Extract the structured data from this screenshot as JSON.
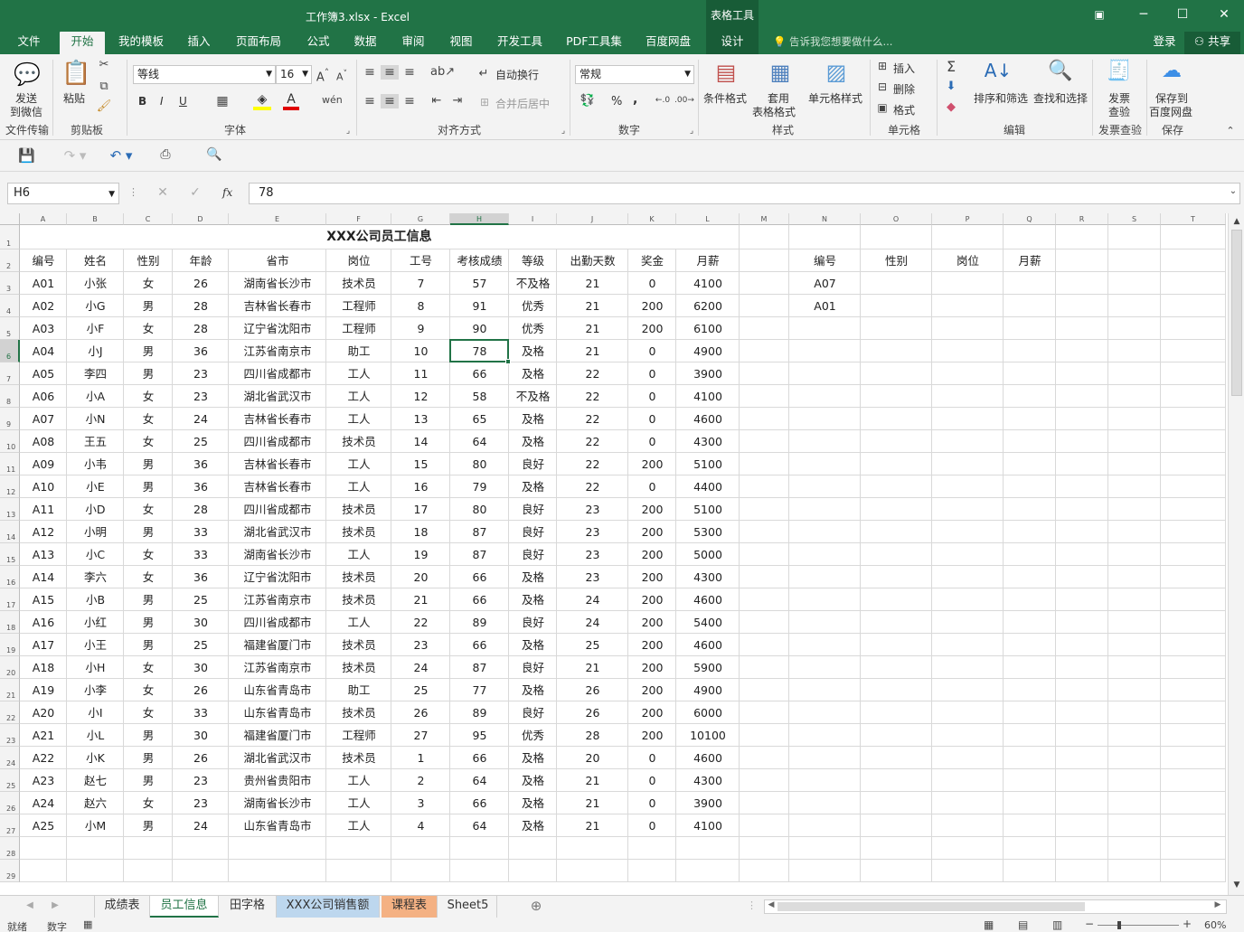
{
  "window": {
    "title": "工作簿3.xlsx - Excel",
    "context_group": "表格工具",
    "restore_icon": "ribbon-display-icon",
    "min": "─",
    "max": "☐",
    "close": "✕"
  },
  "tabs": [
    {
      "label": "文件"
    },
    {
      "label": "开始"
    },
    {
      "label": "我的模板"
    },
    {
      "label": "插入"
    },
    {
      "label": "页面布局"
    },
    {
      "label": "公式"
    },
    {
      "label": "数据"
    },
    {
      "label": "审阅"
    },
    {
      "label": "视图"
    },
    {
      "label": "开发工具"
    },
    {
      "label": "PDF工具集"
    },
    {
      "label": "百度网盘"
    },
    {
      "label": "设计"
    }
  ],
  "tell_me": "告诉我您想要做什么...",
  "login": "登录",
  "share": "共享",
  "ribbon": {
    "send_wechat": [
      "发送",
      "到微信"
    ],
    "paste": "粘贴",
    "font_name": "等线",
    "font_size": "16",
    "bold": "B",
    "italic": "I",
    "underline": "U",
    "wrap_text": "自动换行",
    "merge_center": "合并后居中",
    "number_format": "常规",
    "percent": "%",
    "comma": ",",
    "cond_format": "条件格式",
    "table_format": [
      "套用",
      "表格格式"
    ],
    "cell_style": "单元格样式",
    "insert": "插入",
    "delete": "删除",
    "format": "格式",
    "sort_filter": "排序和筛选",
    "find_select": "查找和选择",
    "invoice": [
      "发票",
      "查验"
    ],
    "save_baidu": [
      "保存到",
      "百度网盘"
    ],
    "groups": [
      "文件传输",
      "剪贴板",
      "字体",
      "对齐方式",
      "数字",
      "样式",
      "单元格",
      "编辑",
      "发票查验",
      "保存"
    ]
  },
  "formula_bar": {
    "name_box": "H6",
    "value": "78",
    "fx": "fx"
  },
  "columns": [
    "A",
    "B",
    "C",
    "D",
    "E",
    "F",
    "G",
    "H",
    "I",
    "J",
    "K",
    "L",
    "M",
    "N",
    "O",
    "P",
    "Q",
    "R",
    "S",
    "T"
  ],
  "rows": [
    "1",
    "2",
    "3",
    "4",
    "5",
    "6",
    "7",
    "8",
    "9",
    "10",
    "11",
    "12",
    "13",
    "14",
    "15",
    "16",
    "17",
    "18",
    "19",
    "20",
    "21",
    "22",
    "23",
    "24",
    "25",
    "26",
    "27",
    "28",
    "29"
  ],
  "sheet_title": "XXX公司员工信息",
  "table": {
    "headers": [
      "编号",
      "姓名",
      "性别",
      "年龄",
      "省市",
      "岗位",
      "工号",
      "考核成绩",
      "等级",
      "出勤天数",
      "奖金",
      "月薪"
    ],
    "rows": [
      [
        "A01",
        "小张",
        "女",
        "26",
        "湖南省长沙市",
        "技术员",
        "7",
        "57",
        "不及格",
        "21",
        "0",
        "4100"
      ],
      [
        "A02",
        "小G",
        "男",
        "28",
        "吉林省长春市",
        "工程师",
        "8",
        "91",
        "优秀",
        "21",
        "200",
        "6200"
      ],
      [
        "A03",
        "小F",
        "女",
        "28",
        "辽宁省沈阳市",
        "工程师",
        "9",
        "90",
        "优秀",
        "21",
        "200",
        "6100"
      ],
      [
        "A04",
        "小J",
        "男",
        "36",
        "江苏省南京市",
        "助工",
        "10",
        "78",
        "及格",
        "21",
        "0",
        "4900"
      ],
      [
        "A05",
        "李四",
        "男",
        "23",
        "四川省成都市",
        "工人",
        "11",
        "66",
        "及格",
        "22",
        "0",
        "3900"
      ],
      [
        "A06",
        "小A",
        "女",
        "23",
        "湖北省武汉市",
        "工人",
        "12",
        "58",
        "不及格",
        "22",
        "0",
        "4100"
      ],
      [
        "A07",
        "小N",
        "女",
        "24",
        "吉林省长春市",
        "工人",
        "13",
        "65",
        "及格",
        "22",
        "0",
        "4600"
      ],
      [
        "A08",
        "王五",
        "女",
        "25",
        "四川省成都市",
        "技术员",
        "14",
        "64",
        "及格",
        "22",
        "0",
        "4300"
      ],
      [
        "A09",
        "小韦",
        "男",
        "36",
        "吉林省长春市",
        "工人",
        "15",
        "80",
        "良好",
        "22",
        "200",
        "5100"
      ],
      [
        "A10",
        "小E",
        "男",
        "36",
        "吉林省长春市",
        "工人",
        "16",
        "79",
        "及格",
        "22",
        "0",
        "4400"
      ],
      [
        "A11",
        "小D",
        "女",
        "28",
        "四川省成都市",
        "技术员",
        "17",
        "80",
        "良好",
        "23",
        "200",
        "5100"
      ],
      [
        "A12",
        "小明",
        "男",
        "33",
        "湖北省武汉市",
        "技术员",
        "18",
        "87",
        "良好",
        "23",
        "200",
        "5300"
      ],
      [
        "A13",
        "小C",
        "女",
        "33",
        "湖南省长沙市",
        "工人",
        "19",
        "87",
        "良好",
        "23",
        "200",
        "5000"
      ],
      [
        "A14",
        "李六",
        "女",
        "36",
        "辽宁省沈阳市",
        "技术员",
        "20",
        "66",
        "及格",
        "23",
        "200",
        "4300"
      ],
      [
        "A15",
        "小B",
        "男",
        "25",
        "江苏省南京市",
        "技术员",
        "21",
        "66",
        "及格",
        "24",
        "200",
        "4600"
      ],
      [
        "A16",
        "小红",
        "男",
        "30",
        "四川省成都市",
        "工人",
        "22",
        "89",
        "良好",
        "24",
        "200",
        "5400"
      ],
      [
        "A17",
        "小王",
        "男",
        "25",
        "福建省厦门市",
        "技术员",
        "23",
        "66",
        "及格",
        "25",
        "200",
        "4600"
      ],
      [
        "A18",
        "小H",
        "女",
        "30",
        "江苏省南京市",
        "技术员",
        "24",
        "87",
        "良好",
        "21",
        "200",
        "5900"
      ],
      [
        "A19",
        "小李",
        "女",
        "26",
        "山东省青岛市",
        "助工",
        "25",
        "77",
        "及格",
        "26",
        "200",
        "4900"
      ],
      [
        "A20",
        "小I",
        "女",
        "33",
        "山东省青岛市",
        "技术员",
        "26",
        "89",
        "良好",
        "26",
        "200",
        "6000"
      ],
      [
        "A21",
        "小L",
        "男",
        "30",
        "福建省厦门市",
        "工程师",
        "27",
        "95",
        "优秀",
        "28",
        "200",
        "10100"
      ],
      [
        "A22",
        "小K",
        "男",
        "26",
        "湖北省武汉市",
        "技术员",
        "1",
        "66",
        "及格",
        "20",
        "0",
        "4600"
      ],
      [
        "A23",
        "赵七",
        "男",
        "23",
        "贵州省贵阳市",
        "工人",
        "2",
        "64",
        "及格",
        "21",
        "0",
        "4300"
      ],
      [
        "A24",
        "赵六",
        "女",
        "23",
        "湖南省长沙市",
        "工人",
        "3",
        "66",
        "及格",
        "21",
        "0",
        "3900"
      ],
      [
        "A25",
        "小M",
        "男",
        "24",
        "山东省青岛市",
        "工人",
        "4",
        "64",
        "及格",
        "21",
        "0",
        "4100"
      ]
    ]
  },
  "lookup": {
    "headers": [
      "编号",
      "性别",
      "岗位",
      "月薪"
    ],
    "ids": [
      "A07",
      "A01"
    ]
  },
  "sheets": [
    {
      "label": "成绩表"
    },
    {
      "label": "员工信息"
    },
    {
      "label": "田字格"
    },
    {
      "label": "XXX公司销售额"
    },
    {
      "label": "课程表"
    },
    {
      "label": "Sheet5"
    }
  ],
  "status": {
    "ready": "就绪",
    "mode": "数字",
    "zoom": "60%"
  },
  "colors": {
    "brand": "#217346",
    "sheet_blue": "#bdd7ee",
    "sheet_orange": "#f4b183"
  }
}
